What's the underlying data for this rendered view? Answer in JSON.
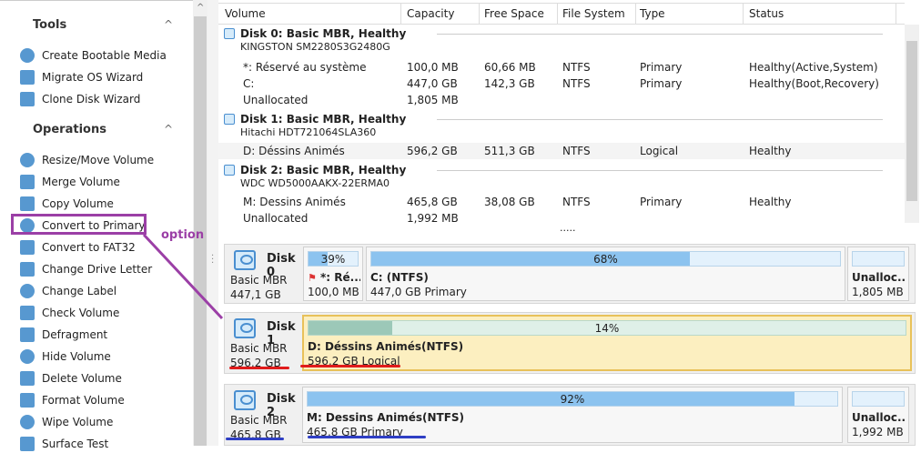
{
  "sidebar": {
    "tools_title": "Tools",
    "tools": [
      {
        "label": "Create Bootable Media",
        "icon": "disc-icon"
      },
      {
        "label": "Migrate OS Wizard",
        "icon": "migrate-icon"
      },
      {
        "label": "Clone Disk Wizard",
        "icon": "clone-icon"
      }
    ],
    "operations_title": "Operations",
    "operations": [
      {
        "label": "Resize/Move Volume",
        "icon": "resize-icon"
      },
      {
        "label": "Merge Volume",
        "icon": "merge-icon"
      },
      {
        "label": "Copy Volume",
        "icon": "copy-icon"
      },
      {
        "label": "Convert to Primary",
        "icon": "convert-icon"
      },
      {
        "label": "Convert to FAT32",
        "icon": "convert-fat-icon"
      },
      {
        "label": "Change Drive Letter",
        "icon": "drive-letter-icon"
      },
      {
        "label": "Change Label",
        "icon": "label-icon"
      },
      {
        "label": "Check Volume",
        "icon": "check-icon"
      },
      {
        "label": "Defragment",
        "icon": "defrag-icon"
      },
      {
        "label": "Hide Volume",
        "icon": "hide-icon"
      },
      {
        "label": "Delete Volume",
        "icon": "delete-icon"
      },
      {
        "label": "Format Volume",
        "icon": "format-icon"
      },
      {
        "label": "Wipe Volume",
        "icon": "wipe-icon"
      },
      {
        "label": "Surface Test",
        "icon": "surface-icon"
      }
    ]
  },
  "table": {
    "columns": [
      "Volume",
      "Capacity",
      "Free Space",
      "File System",
      "Type",
      "Status"
    ],
    "groups": [
      {
        "header": "Disk 0: Basic MBR, Healthy",
        "model": "KINGSTON SM2280S3G2480G",
        "rows": [
          [
            "*: Réservé au système",
            "100,0 MB",
            "60,66 MB",
            "NTFS",
            "Primary",
            "Healthy(Active,System)"
          ],
          [
            "C:",
            "447,0 GB",
            "142,3 GB",
            "NTFS",
            "Primary",
            "Healthy(Boot,Recovery)"
          ],
          [
            "Unallocated",
            "1,805 MB",
            "",
            "",
            "",
            ""
          ]
        ]
      },
      {
        "header": "Disk 1: Basic MBR, Healthy",
        "model": "Hitachi HDT721064SLA360",
        "rows": [
          [
            "D: Déssins Animés",
            "596,2 GB",
            "511,3 GB",
            "NTFS",
            "Logical",
            "Healthy"
          ]
        ]
      },
      {
        "header": "Disk 2: Basic MBR, Healthy",
        "model": "WDC WD5000AAKX-22ERMA0",
        "rows": [
          [
            "M: Dessins Animés",
            "465,8 GB",
            "38,08 GB",
            "NTFS",
            "Primary",
            "Healthy"
          ],
          [
            "Unallocated",
            "1,992 MB",
            "",
            "",
            "",
            ""
          ]
        ]
      }
    ],
    "more": "....."
  },
  "diskmap": [
    {
      "name": "Disk 0",
      "type": "Basic MBR",
      "size": "447,1 GB",
      "parts": [
        {
          "pct": "39%",
          "used": 39,
          "name": "*: Ré...",
          "size": "100,0 MB"
        },
        {
          "pct": "68%",
          "used": 68,
          "name": "C: (NTFS)",
          "size": "447,0 GB Primary"
        },
        {
          "pct": "",
          "used": 0,
          "name": "Unalloc...",
          "size": "1,805 MB"
        }
      ]
    },
    {
      "name": "Disk 1",
      "type": "Basic MBR",
      "size": "596,2 GB",
      "parts": [
        {
          "pct": "14%",
          "used": 14,
          "name": "D: Déssins Animés(NTFS)",
          "size": "596,2 GB Logical",
          "selected": true
        }
      ]
    },
    {
      "name": "Disk 2",
      "type": "Basic MBR",
      "size": "465,8 GB",
      "parts": [
        {
          "pct": "92%",
          "used": 92,
          "name": "M: Dessins Animés(NTFS)",
          "size": "465,8 GB Primary"
        },
        {
          "pct": "",
          "used": 0,
          "name": "Unalloc...",
          "size": "1,992 MB"
        }
      ]
    }
  ],
  "annotation": {
    "label": "option",
    "color": "#9b3fa6"
  },
  "colors": {
    "fill": "#8cc3ef",
    "selected_bg": "#fcefc0",
    "selected_fill": "#9cc8b8",
    "red": "#e01b1b",
    "blue": "#2f3fc4"
  }
}
